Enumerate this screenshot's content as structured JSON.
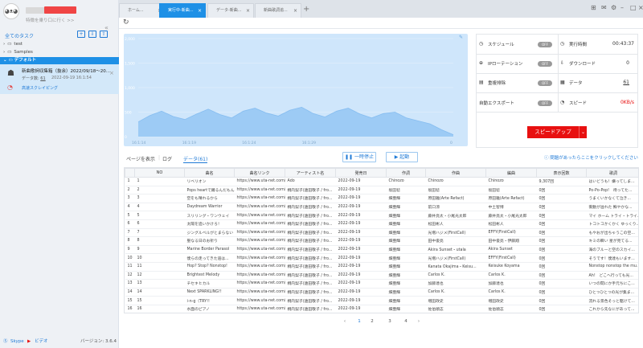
{
  "sidebar": {
    "goto_placeholder": "特徴を乗り口に行く >>",
    "all_tasks": "全てのタスク",
    "tree": [
      {
        "label": "test"
      },
      {
        "label": "Samples"
      }
    ],
    "default_group": "デフォルト",
    "task": {
      "title": "新曲歌詞収集箱（抜余）2022/09/18～20...",
      "count_label": "データ数:",
      "count": "61",
      "date": "2022-09-19 16:1:54",
      "link": "高速スクレイピング"
    },
    "footer": {
      "skype": "Skype",
      "video": "ビデオ",
      "version": "バージョン: 3.6.4"
    }
  },
  "tabs": [
    {
      "label": "ホーム..."
    },
    {
      "label": "実行中-新曲..."
    },
    {
      "label": "データ-新曲..."
    },
    {
      "label": "新曲歌詞追..."
    }
  ],
  "chart_data": {
    "type": "area",
    "x_ticks": [
      "16:1:14",
      "16:1:19",
      "16:1:24",
      "16:1:29"
    ],
    "y_ticks": [
      "2,000",
      "1,500",
      "1,000",
      "500",
      "0"
    ],
    "ylim": [
      0,
      2000
    ],
    "x_end_label": "0",
    "values": [
      300,
      430,
      520,
      410,
      350,
      460,
      560,
      450,
      380,
      520,
      580,
      480,
      420,
      540,
      600,
      470,
      400,
      520,
      580,
      460,
      380,
      470,
      500,
      380,
      320,
      260,
      140,
      40
    ]
  },
  "stats": {
    "schedule": {
      "label": "スケジュール",
      "toggle": "OFF"
    },
    "ip_rotation": {
      "label": "IPローテーション",
      "toggle": "OFF"
    },
    "dedup": {
      "label": "重複排除",
      "toggle": "OFF"
    },
    "auto_export": {
      "label": "自動エクスポート",
      "toggle": "OFF"
    },
    "exec_time": {
      "label": "実行時間",
      "value": "00:43:37"
    },
    "download": {
      "label": "ダウンロード",
      "value": "0"
    },
    "data": {
      "label": "データ",
      "value": "61"
    },
    "speed": {
      "label": "スピード",
      "value": "0KB/s"
    },
    "speedup_label": "スピードアップ",
    "accent": "#e81010"
  },
  "subtabs": {
    "page": "ページを表示",
    "log": "ログ",
    "data": "データ(61)"
  },
  "actions": {
    "pause": "一時停止",
    "start": "起動"
  },
  "help": "問題があったらここをクリックしてください",
  "table": {
    "headers": [
      "",
      "NO",
      "曲名",
      "曲名リンク",
      "アーティスト名",
      "発売日",
      "作詞",
      "作曲",
      "編曲",
      "表示回数",
      "歌詞"
    ],
    "rows": [
      [
        "1",
        "1",
        "リベリオン",
        "https://www.uta-net.com/...",
        "Ado",
        "2022-09-19",
        "Chinozo",
        "Chinozo",
        "Chinozo",
        "9,307回",
        "はいどうも！嫌ってしま..."
      ],
      [
        "2",
        "2",
        "Pops heartで踊るんだもん",
        "https://www.uta-net.com/...",
        "桐内梨子(遠田敬子 / fro...",
        "2022-09-19",
        "坂田稔",
        "坂田稔",
        "坂田稔",
        "0回",
        "Po-Po-Pop!　待ってた..."
      ],
      [
        "3",
        "3",
        "空をも晴れるから",
        "https://www.uta-net.com/...",
        "桐内梨子(遠田敬子 / fro...",
        "2022-09-19",
        "畑亜輝",
        "原田雅(Arte Refact)",
        "原田雅(Arte Refact)",
        "0回",
        "うまくいかなくて泣き..."
      ],
      [
        "4",
        "4",
        "Daydream Warrior",
        "https://www.uta-net.com/...",
        "桐内梨子(遠田敬子 / fro...",
        "2022-09-19",
        "畑亜輝",
        "前口涼",
        "中土智博",
        "0回",
        "衝動が溢れた 鮮やかな..."
      ],
      [
        "5",
        "5",
        "スリリング・ワンウェイ",
        "https://www.uta-net.com/...",
        "桐内梨子(遠田敬子 / fro...",
        "2022-09-19",
        "畑亜輝",
        "藤井亮太・小尾光太郎",
        "藤井亮太・小尾光太郎",
        "0回",
        "マイ ホーム トライ・トライ..."
      ],
      [
        "6",
        "6",
        "太陽を追いかけろ！",
        "https://www.uta-net.com/...",
        "桐内梨子(遠田敬子 / fro...",
        "2022-09-19",
        "畑亜輝",
        "松田彬人",
        "松田彬人",
        "0回",
        "トコトコかくかく ゆっくり..."
      ],
      [
        "7",
        "7",
        "ジングルベルがとまらない",
        "https://www.uta-net.com/...",
        "桐内梨子(遠田敬子 / fro...",
        "2022-09-19",
        "畑亜輝",
        "光増ハジメ(FirstCall)",
        "EFFY(FirstCall)",
        "0回",
        "もやおが出ちゃうこの空..."
      ],
      [
        "8",
        "8",
        "聖なる日のお祈り",
        "https://www.uta-net.com/...",
        "桐内梨子(遠田敬子 / fro...",
        "2022-09-19",
        "畑亜輝",
        "田中俊亮",
        "田中俊亮・伊藤翔",
        "0回",
        "キミの瞬い 星が見てる..."
      ],
      [
        "9",
        "9",
        "Marine Border Parasol",
        "https://www.uta-net.com/...",
        "桐内梨子(遠田敬子 / fro...",
        "2022-09-19",
        "畑亜輝",
        "Akira Sunset・utala",
        "Akira Sunset",
        "0回",
        "海のブルーと空のスカイ..."
      ],
      [
        "10",
        "10",
        "僕らの走ってきた道は...",
        "https://www.uta-net.com/...",
        "桐内梨子(遠田敬子 / fro...",
        "2022-09-19",
        "畑亜輝",
        "光増ハジメ(FirstCall)",
        "EFFY(FirstCall)",
        "0回",
        "そうです！僕達もいます..."
      ],
      [
        "11",
        "11",
        "Hop? Stop? Nonstop!",
        "https://www.uta-net.com/...",
        "桐内梨子(遠田敬子 / fro...",
        "2022-09-19",
        "畑亜輝",
        "Kanata Okajima・Keisu...",
        "Keisuke Koyama",
        "0回",
        "Nonstop nonstop the mu..."
      ],
      [
        "12",
        "12",
        "Brightest Melody",
        "https://www.uta-net.com/...",
        "桐内梨子(遠田敬子 / fro...",
        "2022-09-19",
        "畑亜輝",
        "Carlos K.",
        "Carlos K.",
        "0回",
        "Ah!　どこへ行っても光..."
      ],
      [
        "13",
        "13",
        "チセキヒカル",
        "https://www.uta-net.com/...",
        "桐内梨子(遠田敬子 / fro...",
        "2022-09-19",
        "畑亜輝",
        "加藤達也",
        "加藤達也",
        "0回",
        "いつの間にか手元ちにこ..."
      ],
      [
        "14",
        "14",
        "Next SPARKLING!!",
        "https://www.uta-net.com/...",
        "桐内梨子(遠田敬子 / fro...",
        "2022-09-19",
        "畑亜輝",
        "Carlos K.",
        "Carlos K.",
        "0回",
        "ひとつひとつの光が集ま..."
      ],
      [
        "15",
        "15",
        "i-n-g（TRY!!",
        "https://www.uta-net.com/...",
        "桐内梨子(遠田敬子 / fro...",
        "2022-09-19",
        "畑亜輝",
        "増田政史",
        "増田政史",
        "0回",
        "流れる景色そっと駆けて..."
      ],
      [
        "16",
        "16",
        "水面のピアノ",
        "https://www.uta-net.com/...",
        "桐内梨子(遠田敬子 / fro...",
        "2022-09-19",
        "畑亜輝",
        "佐伯順志",
        "佐伯順志",
        "0回",
        "これから先なにがあって..."
      ]
    ]
  },
  "pagination": [
    "1",
    "2",
    "3",
    "4"
  ]
}
